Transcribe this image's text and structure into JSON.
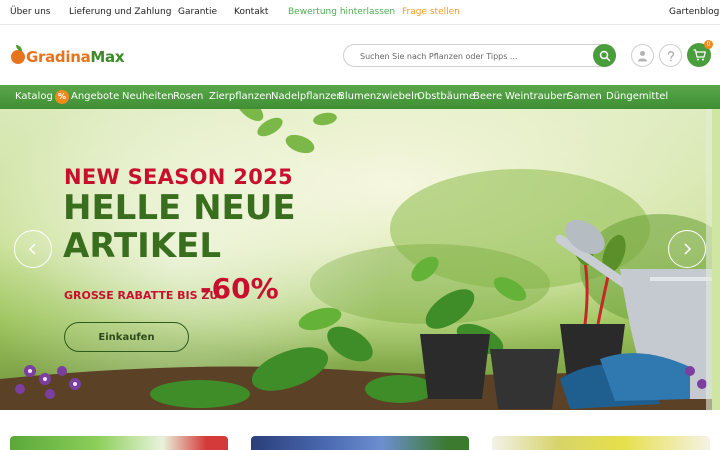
{
  "topbar": {
    "links": [
      "Über uns",
      "Lieferung und Zahlung",
      "Garantie",
      "Kontakt",
      "Bewertung hinterlassen",
      "Frage stellen"
    ],
    "blog": "Gartenblog"
  },
  "header": {
    "logo_part1": "GradinaMax",
    "search_placeholder": "Suchen Sie nach Pflanzen oder Tipps ...",
    "cart_count": "0"
  },
  "nav": {
    "items": [
      "Katalog",
      "Angebote",
      "Neuheiten",
      "Rosen",
      "Zierpflanzen",
      "Nadelpflanzen",
      "Blumenzwiebeln",
      "Obstbäume",
      "Beere",
      "Weintrauben",
      "Samen",
      "Düngemittel"
    ],
    "percent_badge": "%"
  },
  "hero": {
    "line1": "NEW SEASON 2025",
    "line2": "HELLE NEUE",
    "line3": "ARTIKEL",
    "discount_text": "GROSSE RABATTE BIS ZU",
    "discount_value": "-60%",
    "button": "Einkaufen"
  },
  "colors": {
    "brand_green": "#4a9d3c",
    "accent_orange": "#f08a1c",
    "hero_red": "#c8102e",
    "hero_green": "#3a6e1f"
  }
}
